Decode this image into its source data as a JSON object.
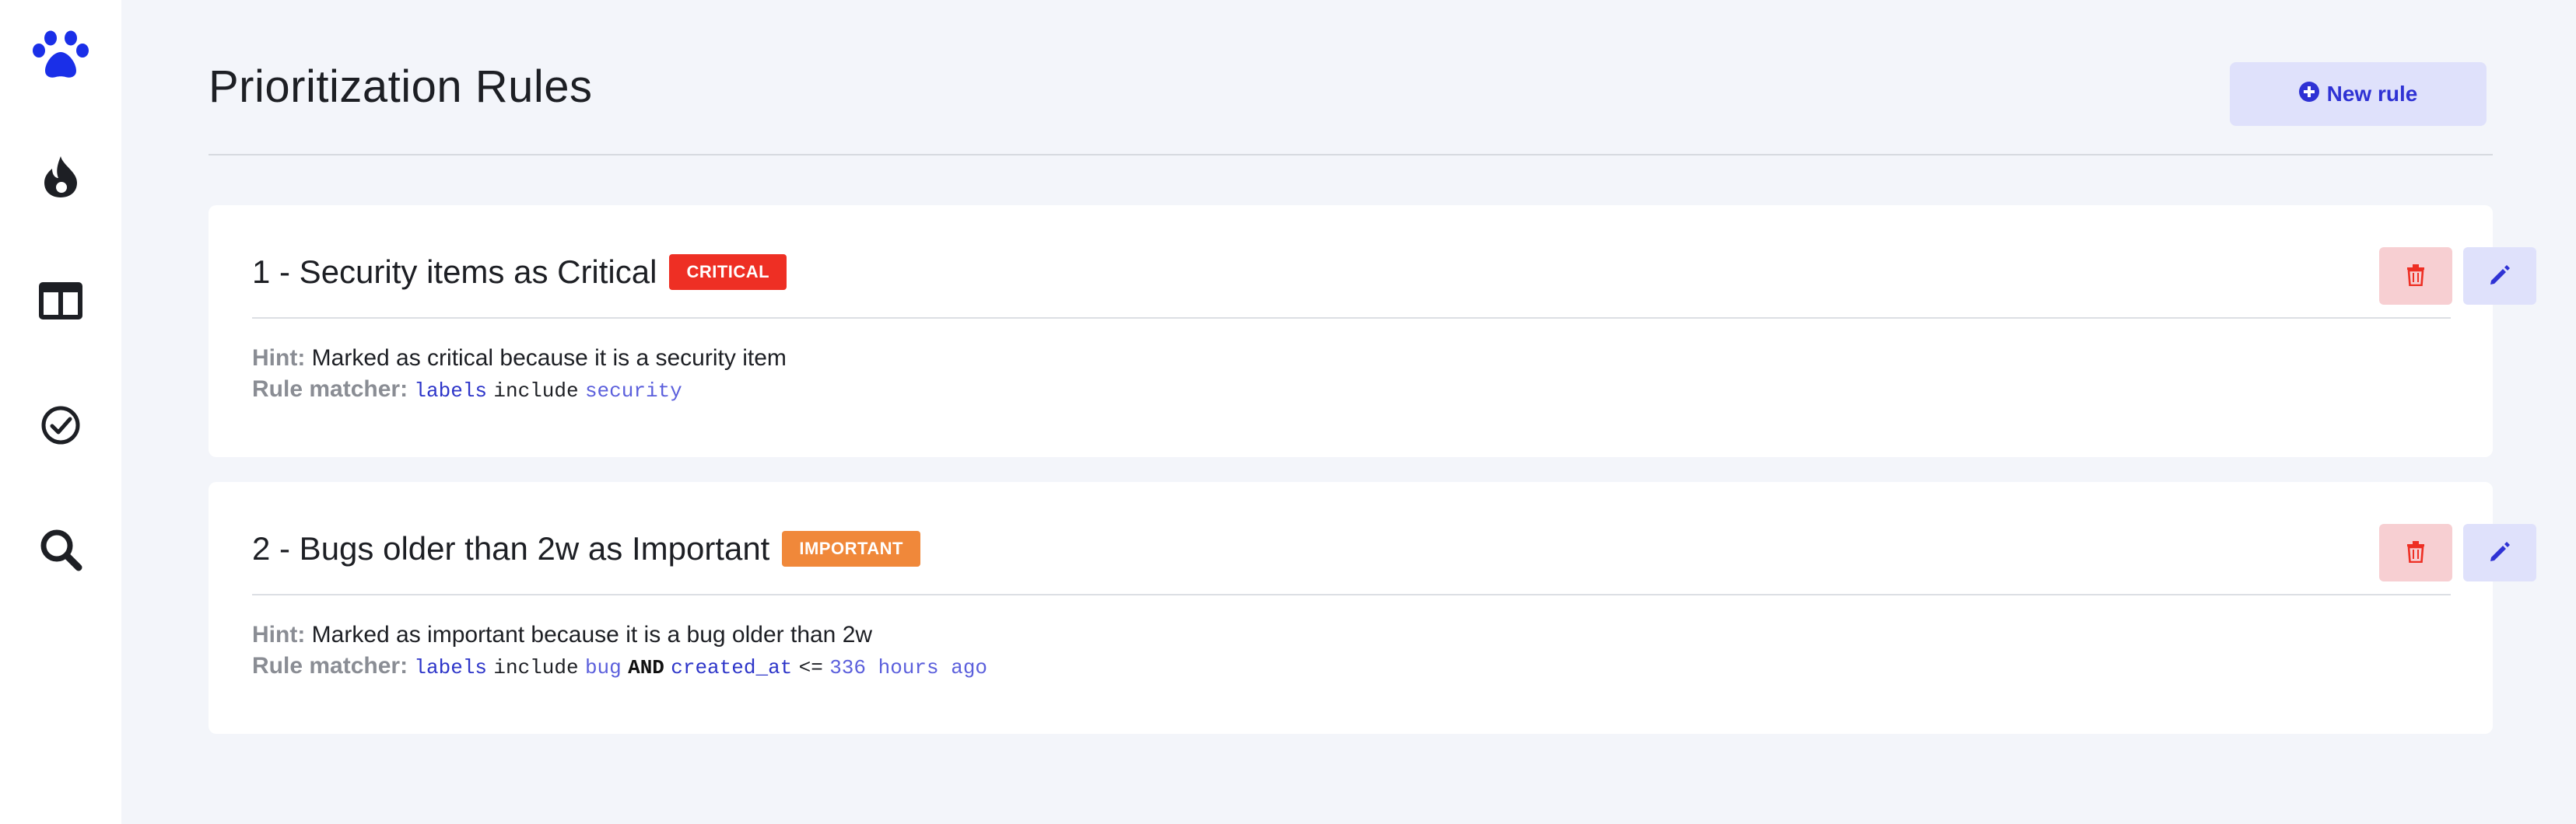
{
  "sidebar": {
    "items": [
      {
        "icon": "paw-icon",
        "color": "#1a2fe8"
      },
      {
        "icon": "flame-icon",
        "color": "#1d1f24"
      },
      {
        "icon": "columns-icon",
        "color": "#1d1f24"
      },
      {
        "icon": "check-circle-icon",
        "color": "#1d1f24"
      },
      {
        "icon": "search-icon",
        "color": "#1d1f24"
      }
    ]
  },
  "header": {
    "title": "Prioritization Rules",
    "new_rule_label": "New rule",
    "new_rule_icon": "plus-circle-icon"
  },
  "rules": [
    {
      "title": "1 - Security items as Critical",
      "badge": "CRITICAL",
      "badge_color": "#ee2f24",
      "hint_label": "Hint:",
      "hint": "Marked as critical because it is a security item",
      "matcher_label": "Rule matcher:",
      "matcher": {
        "field1": "labels",
        "op1": "include",
        "value1": "security"
      }
    },
    {
      "title": "2 - Bugs older than 2w as Important",
      "badge": "IMPORTANT",
      "badge_color": "#f0883a",
      "hint_label": "Hint:",
      "hint": "Marked as important because it is a bug older than 2w",
      "matcher_label": "Rule matcher:",
      "matcher": {
        "field1": "labels",
        "op1": "include",
        "value1": "bug",
        "joiner": "AND",
        "field2": "created_at",
        "op2": "<=",
        "value2": "336 hours ago"
      }
    }
  ],
  "colors": {
    "accent": "#2f32d4",
    "delete": "#ee2f24",
    "background": "#f3f5fa"
  }
}
